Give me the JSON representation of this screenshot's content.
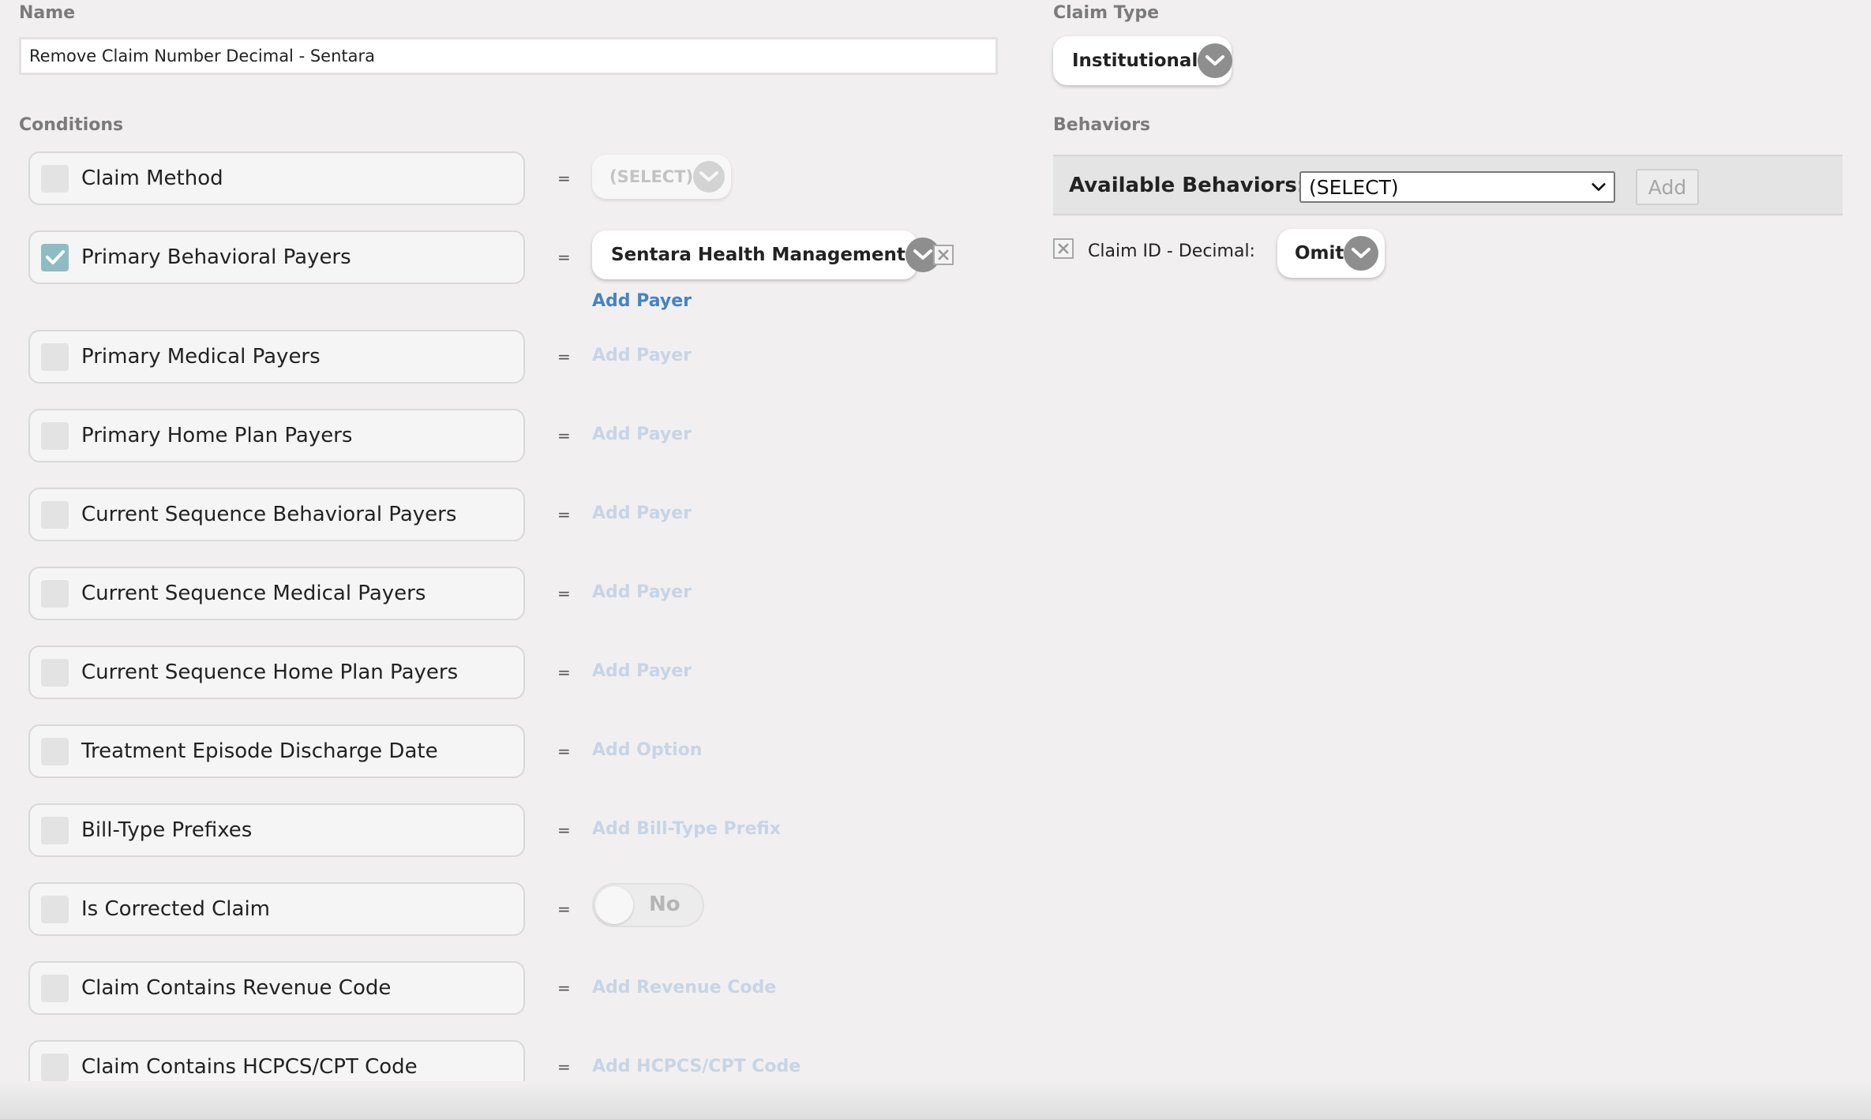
{
  "name_section": {
    "label": "Name",
    "value": "Remove Claim Number Decimal - Sentara"
  },
  "claim_type": {
    "label": "Claim Type",
    "selected": "Institutional"
  },
  "conditions": {
    "label": "Conditions",
    "rows": [
      {
        "label": "Claim Method",
        "checked": false,
        "value_type": "select",
        "value": "(SELECT)"
      },
      {
        "label": "Primary Behavioral Payers",
        "checked": true,
        "value_type": "select",
        "value": "Sentara Health Management",
        "add_link": "Add Payer"
      },
      {
        "label": "Primary Medical Payers",
        "checked": false,
        "value_type": "link",
        "add_link": "Add Payer"
      },
      {
        "label": "Primary Home Plan Payers",
        "checked": false,
        "value_type": "link",
        "add_link": "Add Payer"
      },
      {
        "label": "Current Sequence Behavioral Payers",
        "checked": false,
        "value_type": "link",
        "add_link": "Add Payer"
      },
      {
        "label": "Current Sequence Medical Payers",
        "checked": false,
        "value_type": "link",
        "add_link": "Add Payer"
      },
      {
        "label": "Current Sequence Home Plan Payers",
        "checked": false,
        "value_type": "link",
        "add_link": "Add Payer"
      },
      {
        "label": "Treatment Episode Discharge Date",
        "checked": false,
        "value_type": "link",
        "add_link": "Add Option"
      },
      {
        "label": "Bill-Type Prefixes",
        "checked": false,
        "value_type": "link",
        "add_link": "Add Bill-Type Prefix"
      },
      {
        "label": "Is Corrected Claim",
        "checked": false,
        "value_type": "toggle",
        "value": "No"
      },
      {
        "label": "Claim Contains Revenue Code",
        "checked": false,
        "value_type": "link",
        "add_link": "Add Revenue Code"
      },
      {
        "label": "Claim Contains HCPCS/CPT Code",
        "checked": false,
        "value_type": "link",
        "add_link": "Add HCPCS/CPT Code"
      }
    ],
    "equals_sign": "="
  },
  "behaviors": {
    "label": "Behaviors",
    "available_label": "Available Behaviors:",
    "select_value": "(SELECT)",
    "add_button": "Add",
    "items": [
      {
        "label": "Claim ID - Decimal:",
        "value": "Omit"
      }
    ]
  },
  "colors": {
    "background": "#f1eff0",
    "link_active": "#4683c2",
    "link_disabled": "#c6d5e6",
    "checkbox_checked": "#8fbcc2",
    "chevron_circle": "#8e8e8e"
  },
  "icons": {
    "dropdown": "chevron-down-icon",
    "checkmark": "check-icon",
    "remove": "close-box-icon"
  }
}
